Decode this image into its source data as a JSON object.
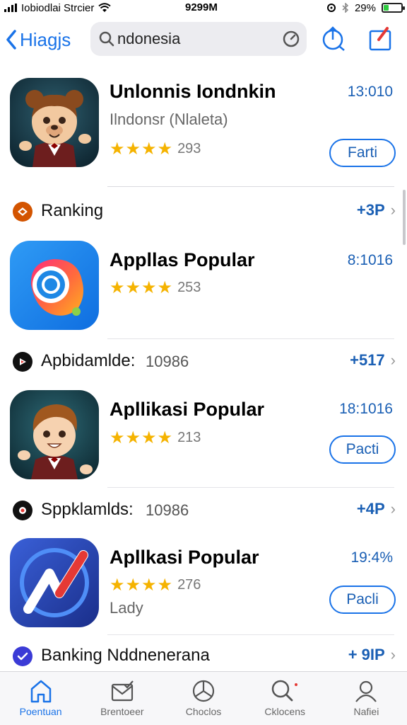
{
  "status": {
    "carrier": "Iobiodlai Strcier",
    "time": "9299M",
    "battery": "29%",
    "battery_level": 0.29
  },
  "nav": {
    "back_label": "Hiagjs",
    "search_value": "ndonesia",
    "search_placeholder": "Search"
  },
  "featured": {
    "title": "Unlonnis Iondnkin",
    "subtitle": "Ilndonsr (Nlaleta)",
    "rating_count": "293",
    "meta": "13:010",
    "button": "Farti"
  },
  "sections": [
    {
      "title": "Ranking",
      "count": "",
      "link": "+3P",
      "icon_color": "#d35400"
    },
    {
      "title": "Apbidamlde:",
      "count": "10986",
      "link": "+517",
      "icon_color": "#111111"
    },
    {
      "title": "Sppklamlds:",
      "count": "10986",
      "link": "+4P",
      "icon_color": "#111111"
    },
    {
      "title": "Banking Nddnenerana",
      "count": "",
      "link": "+ 9IP",
      "icon_color": "#3b3bd6"
    }
  ],
  "apps": [
    {
      "title": "Appllas Popular",
      "rating_count": "253",
      "meta": "8:1016",
      "subtitle": "",
      "button": ""
    },
    {
      "title": "Apllikasi Popular",
      "rating_count": "213",
      "meta": "18:1016",
      "subtitle": "",
      "button": "Pacti"
    },
    {
      "title": "Apllkasi Popular",
      "rating_count": "276",
      "meta": "19:4%",
      "subtitle": "Lady",
      "button": "Pacli"
    }
  ],
  "stars": "★★★★",
  "chevron": "›",
  "tabs": [
    {
      "label": "Poentuan",
      "icon": "home-icon",
      "active": true
    },
    {
      "label": "Brentoeer",
      "icon": "mail-check-icon",
      "active": false
    },
    {
      "label": "Choclos",
      "icon": "mercedes-icon",
      "active": false
    },
    {
      "label": "Cklocens",
      "icon": "search-icon",
      "active": false
    },
    {
      "label": "Nafiei",
      "icon": "person-icon",
      "active": false
    }
  ],
  "colors": {
    "accent": "#1a73e8",
    "star": "#f5b301",
    "battery": "#2ecc40"
  }
}
